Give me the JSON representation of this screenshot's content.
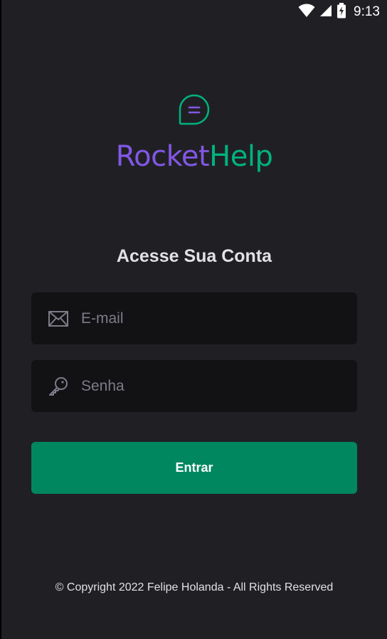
{
  "status_bar": {
    "time": "9:13",
    "icons": [
      "wifi-icon",
      "cell-signal-icon",
      "battery-charging-icon"
    ]
  },
  "brand": {
    "icon": "chat-bubble-icon",
    "name_part1": "Rocket",
    "name_part2": "Help",
    "color_primary": "#8257E5",
    "color_secondary": "#00B37E"
  },
  "login": {
    "heading": "Acesse Sua Conta",
    "email": {
      "icon": "envelope-icon",
      "placeholder": "E-mail",
      "value": ""
    },
    "password": {
      "icon": "key-icon",
      "placeholder": "Senha",
      "value": ""
    },
    "submit_label": "Entrar",
    "submit_color": "#00875F"
  },
  "footer": {
    "text": "© Copyright 2022 Felipe Holanda - All Rights Reserved"
  }
}
